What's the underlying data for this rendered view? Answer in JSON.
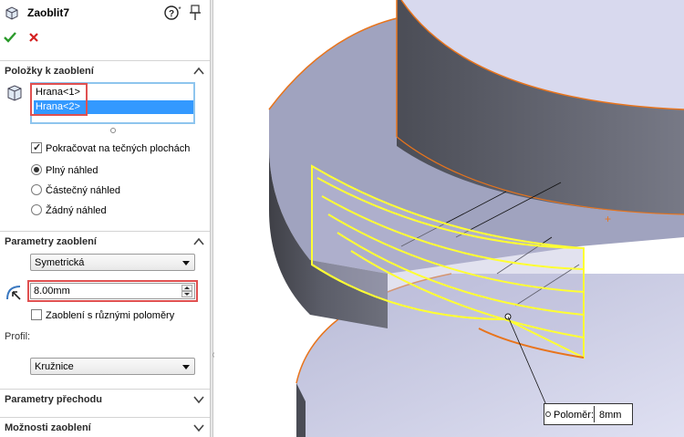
{
  "feature": {
    "title": "Zaoblit7",
    "ok_symbol": "✔",
    "cancel_symbol": "✖"
  },
  "items_group": {
    "title": "Položky k zaoblení",
    "edges": [
      "Hrana<1>",
      "Hrana<2>"
    ],
    "tangent_propagation": {
      "label": "Pokračovat na tečných plochách",
      "checked": true
    },
    "preview_options": [
      {
        "label": "Plný náhled",
        "selected": true
      },
      {
        "label": "Částečný náhled",
        "selected": false
      },
      {
        "label": "Žádný náhled",
        "selected": false
      }
    ]
  },
  "parameters_group": {
    "title": "Parametry zaoblení",
    "type_select": "Symetrická",
    "radius_value": "8.00mm",
    "multi_radius": {
      "label": "Zaoblení s různými poloměry",
      "checked": false
    },
    "profile_label": "Profil:",
    "profile_select": "Kružnice"
  },
  "transition_group": {
    "title": "Parametry přechodu"
  },
  "options_group": {
    "title": "Možnosti zaoblení"
  },
  "callout": {
    "label": "Poloměr:",
    "value": "8mm"
  },
  "colors": {
    "selection_blue": "#3399ff",
    "highlight_red": "#e05050",
    "preview_yellow": "#ffff33",
    "edge_orange": "#e8741c",
    "ok_green": "#2a9a2a",
    "cancel_red": "#d42020"
  },
  "icons": {
    "title": "fillet-feature-icon",
    "help": "help-icon",
    "pin": "pushpin-icon",
    "edges": "edge-selection-icon",
    "radius": "radius-icon"
  }
}
